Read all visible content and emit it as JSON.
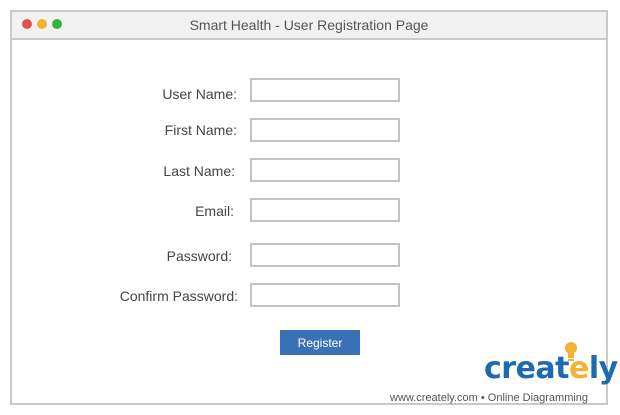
{
  "window": {
    "title": "Smart Health - User Registration Page"
  },
  "form": {
    "fields": [
      {
        "label": "User Name:",
        "value": ""
      },
      {
        "label": "First Name:",
        "value": ""
      },
      {
        "label": "Last Name:",
        "value": ""
      },
      {
        "label": "Email:",
        "value": ""
      },
      {
        "label": "Password:",
        "value": ""
      },
      {
        "label": "Confirm Password:",
        "value": ""
      }
    ],
    "submit_label": "Register"
  },
  "branding": {
    "logo_prefix": "creat",
    "logo_e": "e",
    "logo_suffix": "ly",
    "footer": "www.creately.com • Online Diagramming"
  },
  "colors": {
    "accent": "#3a71b6",
    "logo_blue": "#1d6ab0",
    "logo_yellow": "#f2b233",
    "dot_red": "#e0524f",
    "dot_yellow": "#f2b233",
    "dot_green": "#36b43a"
  }
}
